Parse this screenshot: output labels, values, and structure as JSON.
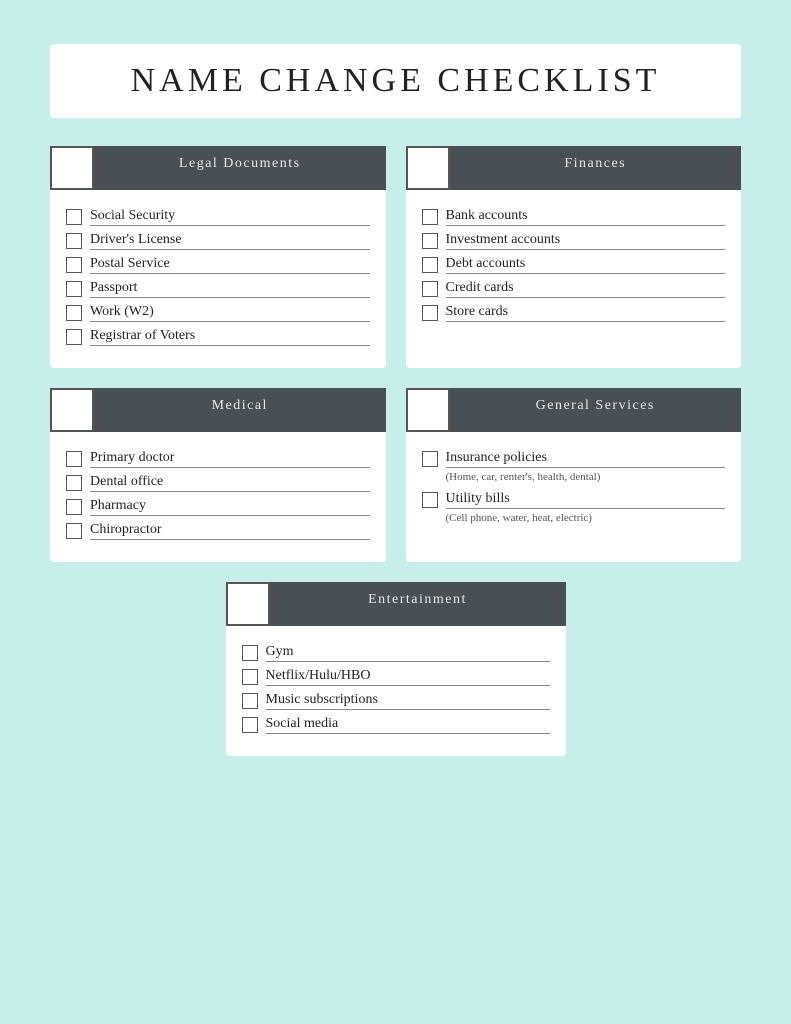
{
  "title": "NAME CHANGE CHECKLIST",
  "sections": [
    {
      "id": "legal",
      "header": "Legal Documents",
      "items": [
        {
          "label": "Social Security"
        },
        {
          "label": "Driver's License"
        },
        {
          "label": "Postal Service"
        },
        {
          "label": "Passport"
        },
        {
          "label": "Work (W2)"
        },
        {
          "label": "Registrar of Voters"
        }
      ]
    },
    {
      "id": "finances",
      "header": "Finances",
      "items": [
        {
          "label": "Bank accounts"
        },
        {
          "label": "Investment accounts"
        },
        {
          "label": "Debt accounts"
        },
        {
          "label": "Credit cards"
        },
        {
          "label": "Store cards"
        }
      ]
    },
    {
      "id": "medical",
      "header": "Medical",
      "items": [
        {
          "label": "Primary doctor"
        },
        {
          "label": "Dental office"
        },
        {
          "label": "Pharmacy"
        },
        {
          "label": "Chiropractor"
        }
      ]
    },
    {
      "id": "general",
      "header": "General Services",
      "items": [
        {
          "label": "Insurance policies",
          "sub": "(Home, car, renter's, health, dental)"
        },
        {
          "label": "Utility bills",
          "sub": "(Cell phone, water, heat, electric)"
        }
      ]
    },
    {
      "id": "entertainment",
      "header": "Entertainment",
      "items": [
        {
          "label": "Gym"
        },
        {
          "label": "Netflix/Hulu/HBO"
        },
        {
          "label": "Music subscriptions"
        },
        {
          "label": "Social media"
        }
      ]
    }
  ]
}
